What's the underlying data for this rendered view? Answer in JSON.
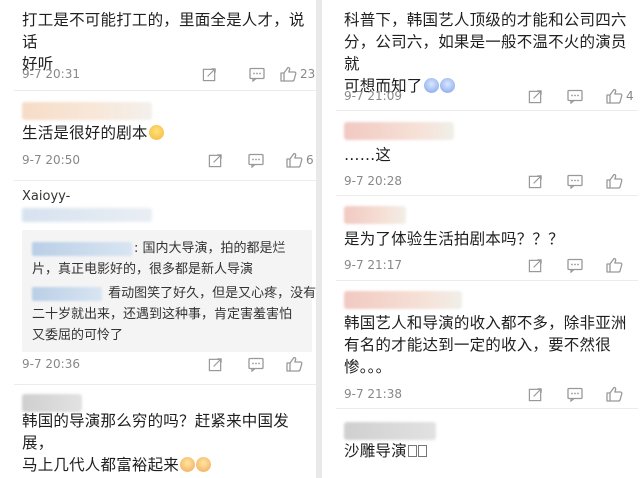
{
  "left": {
    "comments": [
      {
        "text_lines": [
          "打工是不可能打工的，里面全是人才，说话",
          "好听"
        ],
        "time": "9-7 20:31",
        "likes": "23"
      },
      {
        "text": "生活是很好的剧本",
        "emoji": "grin-emoji",
        "time": "9-7 20:50",
        "likes": "6"
      },
      {
        "username": "Xaioyy-",
        "replies": [
          {
            "line1": ": 国内大导演，拍的都是烂",
            "line2": "片，真正电影好的，很多都是新人导演"
          },
          {
            "line1": " 看动图笑了好久，但是又心疼，没有",
            "line2": "二十岁就出来，还遇到这种事，肯定害羞害怕",
            "line3": "又委屈的可怜了"
          }
        ],
        "time": "9-7 20:36",
        "likes": ""
      },
      {
        "text_lines": [
          "韩国的导演那么穷的吗？赶紧来中国发展，",
          "马上几代人都富裕起来"
        ],
        "emoji": "laugh-emoji"
      }
    ]
  },
  "right": {
    "comments": [
      {
        "text_lines": [
          "科普下，韩国艺人顶级的才能和公司四六",
          "分，公司六，如果是一般不温不火的演员就",
          "可想而知了"
        ],
        "emoji": "dizzy-emoji",
        "time": "9-7 21:09",
        "likes": "4"
      },
      {
        "text": "……这",
        "time": "9-7 20:28",
        "likes": ""
      },
      {
        "text": "是为了体验生活拍剧本吗？？？",
        "time": "9-7 21:17",
        "likes": ""
      },
      {
        "text_lines": [
          "韩国艺人和导演的收入都不多，除非亚洲",
          "有名的才能达到一定的收入，要不然很",
          "惨。。。"
        ],
        "time": "9-7 21:38",
        "likes": ""
      },
      {
        "text": "沙雕导演",
        "emoji": "unknown-glyph"
      }
    ]
  },
  "icons": {
    "share": "share-icon",
    "comment": "comment-icon",
    "like": "thumbs-up-icon"
  }
}
